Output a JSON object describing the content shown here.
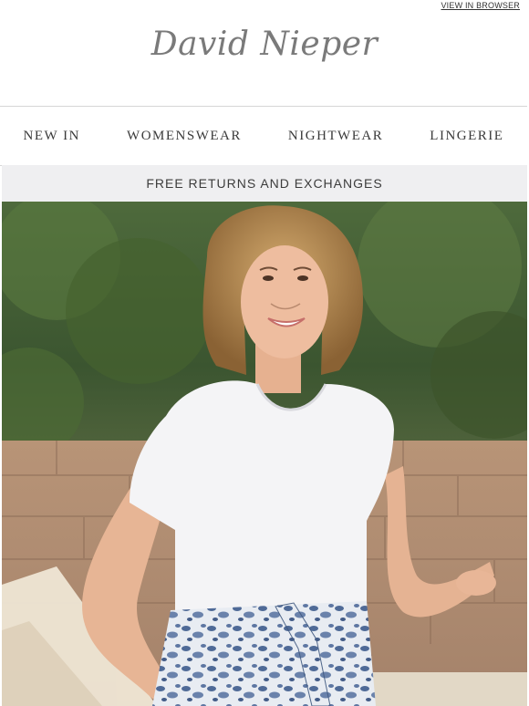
{
  "header": {
    "view_in_browser": "VIEW IN BROWSER",
    "logo_text": "David Nieper"
  },
  "nav": {
    "items": [
      "NEW IN",
      "WOMENSWEAR",
      "NIGHTWEAR",
      "LINGERIE"
    ]
  },
  "banner": {
    "text": "FREE RETURNS AND EXCHANGES"
  },
  "hero": {
    "image_subject": "woman in white t-shirt and blue patterned skirt outdoors"
  },
  "colors": {
    "logo": "#7a7a7a",
    "banner_bg": "#efeff1",
    "nav_text": "#3a3a3a"
  }
}
